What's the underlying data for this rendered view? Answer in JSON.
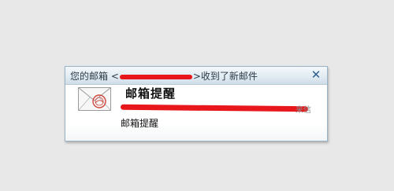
{
  "notification": {
    "title_prefix": "您的邮箱 <",
    "title_suffix": ">收到了新邮件",
    "close_symbol": "✕",
    "heading": "邮箱提醒",
    "sender_tail": "来信",
    "subject": "邮箱提醒"
  },
  "icons": {
    "mail": "envelope-with-stamp-icon",
    "close": "close-icon"
  },
  "colors": {
    "redaction": "#e8171b",
    "stamp": "#d0463c",
    "close": "#2f5f8e"
  }
}
